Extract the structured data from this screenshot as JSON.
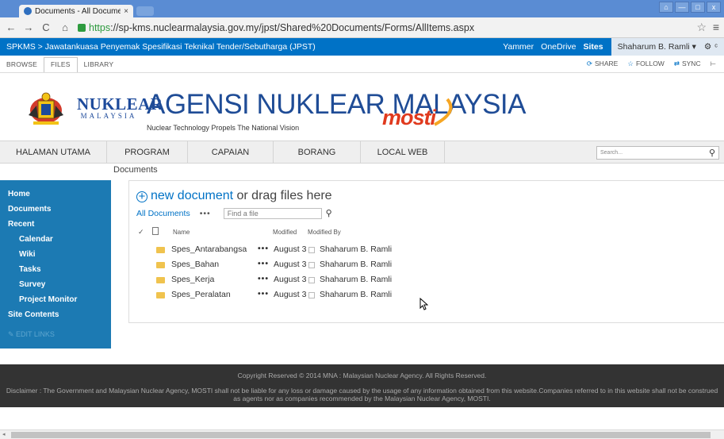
{
  "browser": {
    "tab_title": "Documents - All Documen",
    "tab_close": "×",
    "url_scheme": "https",
    "url_rest": "://sp-kms.nuclearmalaysia.gov.my/jpst/Shared%20Documents/Forms/AllItems.aspx",
    "window_buttons": [
      "⌂",
      "—",
      "□",
      "x"
    ]
  },
  "suite": {
    "breadcrumb": "SPKMS > Jawatankuasa Penyemak Spesifikasi Teknikal Tender/Sebutharga (JPST)",
    "links": [
      "Yammer",
      "OneDrive",
      "Sites"
    ],
    "user": "Shaharum B. Ramli ▾"
  },
  "ribbon": {
    "tabs": [
      "BROWSE",
      "FILES",
      "LIBRARY"
    ],
    "actions": [
      {
        "icon": "share-icon",
        "label": "SHARE"
      },
      {
        "icon": "follow-star-icon",
        "label": "FOLLOW"
      },
      {
        "icon": "sync-icon",
        "label": "SYNC"
      }
    ]
  },
  "banner": {
    "logo_line1": "NUKLEAR",
    "logo_line2": "MALAYSIA",
    "agency": "AGENSI NUKLEAR MALAYSIA",
    "tagline": "Nuclear Technology Propels The National Vision",
    "mosti": "mosti"
  },
  "topnav": {
    "items": [
      "HALAMAN UTAMA",
      "PROGRAM",
      "CAPAIAN",
      "BORANG",
      "LOCAL WEB"
    ],
    "search_placeholder": "Search..."
  },
  "page_crumb": "Documents",
  "leftnav": {
    "items": [
      {
        "label": "Home",
        "sub": false
      },
      {
        "label": "Documents",
        "sub": false
      },
      {
        "label": "Recent",
        "sub": false
      },
      {
        "label": "Calendar",
        "sub": true
      },
      {
        "label": "Wiki",
        "sub": true
      },
      {
        "label": "Tasks",
        "sub": true
      },
      {
        "label": "Survey",
        "sub": true
      },
      {
        "label": "Project Monitor",
        "sub": true
      },
      {
        "label": "Site Contents",
        "sub": false
      }
    ],
    "edit_links": "✎ EDIT LINKS"
  },
  "library": {
    "new_document": "new document",
    "drag_text": " or drag files here",
    "view_name": "All Documents",
    "more": "•••",
    "find_placeholder": "Find a file",
    "headers": {
      "check": "✓",
      "name": "Name",
      "modified": "Modified",
      "modified_by": "Modified By"
    },
    "rows": [
      {
        "name": "Spes_Antarabangsa",
        "modified": "August 3",
        "by": "Shaharum B. Ramli"
      },
      {
        "name": "Spes_Bahan",
        "modified": "August 3",
        "by": "Shaharum B. Ramli"
      },
      {
        "name": "Spes_Kerja",
        "modified": "August 3",
        "by": "Shaharum B. Ramli"
      },
      {
        "name": "Spes_Peralatan",
        "modified": "August 3",
        "by": "Shaharum B. Ramli"
      }
    ]
  },
  "footer": {
    "copyright": "Copyright Reserved © 2014 MNA : Malaysian Nuclear Agency. All Rights Reserved.",
    "disclaimer": "Disclaimer : The Government and Malaysian Nuclear Agency, MOSTI shall not be liable for any loss or damage caused by the usage of any information obtained from this website.Companies referred to in this website shall not be construed as agents nor as companies recommended by the Malaysian Nuclear Agency, MOSTI."
  },
  "colors": {
    "suite_bar": "#0072c6",
    "left_nav": "#1c7ab3",
    "agency_blue": "#1f4c96",
    "mosti_red": "#e03a1e",
    "footer": "#333333"
  }
}
